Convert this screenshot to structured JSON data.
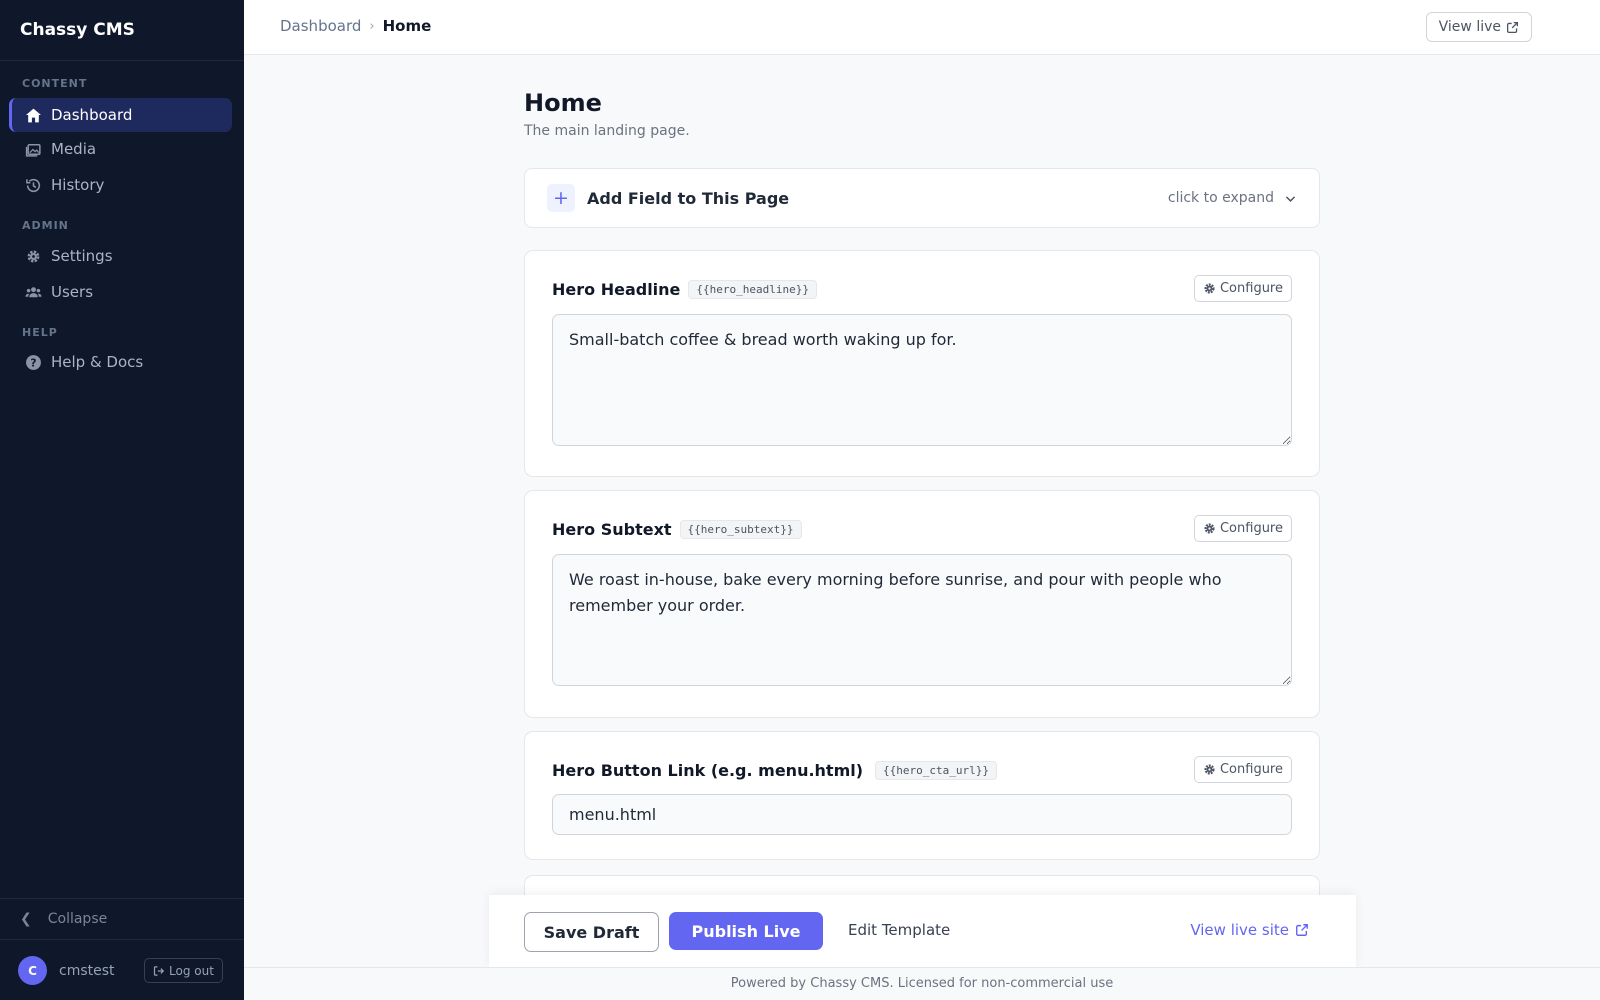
{
  "app": {
    "name": "Chassy CMS"
  },
  "sidebar": {
    "sections": {
      "content": "CONTENT",
      "admin": "ADMIN",
      "help": "HELP"
    },
    "items": [
      {
        "label": "Dashboard",
        "icon": "home-icon",
        "active": true
      },
      {
        "label": "Media",
        "icon": "images-icon"
      },
      {
        "label": "History",
        "icon": "history-icon"
      },
      {
        "label": "Settings",
        "icon": "gear-icon"
      },
      {
        "label": "Users",
        "icon": "users-icon"
      },
      {
        "label": "Help & Docs",
        "icon": "question-circle-icon"
      }
    ],
    "collapse_label": "Collapse",
    "user": {
      "initial": "C",
      "name": "cmstest",
      "logout_label": "Log out"
    }
  },
  "topbar": {
    "breadcrumb": {
      "parent": "Dashboard",
      "current": "Home"
    },
    "view_live_label": "View live"
  },
  "page": {
    "title": "Home",
    "description": "The main landing page.",
    "add_field": {
      "label": "Add Field to This Page",
      "hint": "click to expand"
    }
  },
  "fields": [
    {
      "label": "Hero Headline",
      "token": "{{hero_headline}}",
      "value": "Small-batch coffee & bread worth waking up for.",
      "configure_label": "Configure"
    },
    {
      "label": "Hero Subtext",
      "token": "{{hero_subtext}}",
      "value": "We roast in-house, bake every morning before sunrise, and pour with people who remember your order.",
      "configure_label": "Configure"
    },
    {
      "label": "Hero Button Link (e.g. menu.html)",
      "token": "{{hero_cta_url}}",
      "value": "menu.html",
      "configure_label": "Configure"
    }
  ],
  "actions": {
    "save_draft": "Save Draft",
    "publish": "Publish Live",
    "edit_template": "Edit Template",
    "view_live_site": "View live site"
  },
  "footer": {
    "text": "Powered by Chassy CMS. Licensed for non-commercial use"
  },
  "colors": {
    "accent": "#6366f1",
    "sidebar_bg": "#0f172a",
    "page_bg": "#f8f9fb"
  }
}
